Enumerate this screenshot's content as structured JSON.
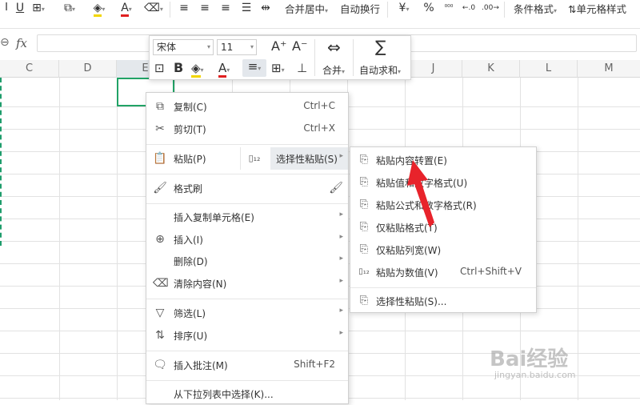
{
  "ribbon": {
    "merge_center": "合并居中",
    "wrap_text": "自动换行",
    "currency_symbol": "¥",
    "percent_symbol": "%",
    "cond_format": "条件格式",
    "cell_style": "单元格样式"
  },
  "formula_bar": {
    "fx": "fx",
    "value": ""
  },
  "columns": [
    "C",
    "D",
    "E",
    "F",
    "G",
    "H",
    "I",
    "J",
    "K",
    "L",
    "M"
  ],
  "mini_toolbar": {
    "font_name": "宋体",
    "font_size": "11",
    "bold": "B",
    "merge_label": "合并",
    "autosum_label": "自动求和"
  },
  "context_menu": {
    "copy": {
      "label": "复制(C)",
      "shortcut": "Ctrl+C"
    },
    "cut": {
      "label": "剪切(T)",
      "shortcut": "Ctrl+X"
    },
    "paste": {
      "label": "粘贴(P)"
    },
    "paste_special": {
      "label": "选择性粘贴(S)"
    },
    "format_painter": {
      "label": "格式刷"
    },
    "insert_copied": {
      "label": "插入复制单元格(E)"
    },
    "insert": {
      "label": "插入(I)"
    },
    "delete": {
      "label": "删除(D)"
    },
    "clear": {
      "label": "清除内容(N)"
    },
    "filter": {
      "label": "筛选(L)"
    },
    "sort": {
      "label": "排序(U)"
    },
    "insert_comment": {
      "label": "插入批注(M)",
      "shortcut": "Shift+F2"
    },
    "pick_from_list": {
      "label": "从下拉列表中选择(K)..."
    }
  },
  "paste_submenu": {
    "transpose": {
      "label": "粘贴内容转置(E)"
    },
    "values_number_format": {
      "label": "粘贴值和数字格式(U)"
    },
    "formulas_number_format": {
      "label": "粘贴公式和数字格式(R)"
    },
    "formats_only": {
      "label": "仅粘贴格式(T)"
    },
    "column_width_only": {
      "label": "仅粘贴列宽(W)"
    },
    "as_values": {
      "label": "粘贴为数值(V)",
      "shortcut": "Ctrl+Shift+V"
    },
    "paste_special": {
      "label": "选择性粘贴(S)..."
    }
  },
  "watermark": {
    "brand": "Bai经验",
    "url": "jingyan.baidu.com"
  },
  "colors": {
    "accent_green": "#21a366",
    "arrow_red": "#e8232b"
  }
}
